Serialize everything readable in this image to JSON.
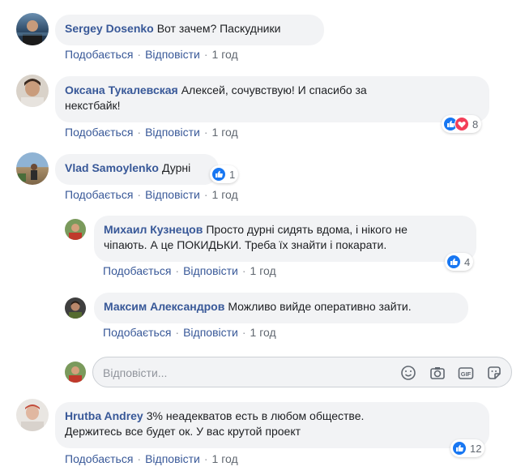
{
  "comments": [
    {
      "author": "Sergey Dosenko",
      "text": "Вот зачем? Паскудники",
      "like": "Подобається",
      "reply": "Відповісти",
      "time": "1 год"
    },
    {
      "author": "Оксана Тукалевская",
      "text_line1": "Алексей, сочувствую! И спасибо за",
      "text_line2": "некстбайк!",
      "like": "Подобається",
      "reply": "Відповісти",
      "time": "1 год",
      "reactions": {
        "count": "8",
        "icons": [
          "like-icon",
          "love-icon"
        ]
      }
    },
    {
      "author": "Vlad Samoylenko",
      "text": "Дурні",
      "like": "Подобається",
      "reply": "Відповісти",
      "time": "1 год",
      "reactions": {
        "count": "1",
        "icons": [
          "like-icon"
        ]
      }
    },
    {
      "author": "Hrutba Andrey",
      "text_line1": "3% неадекватов есть в любом обществе.",
      "text_line2": "Держитесь все будет ок. У вас крутой проект",
      "like": "Подобається",
      "reply": "Відповісти",
      "time": "1 год",
      "reactions": {
        "count": "12",
        "icons": [
          "like-icon"
        ]
      }
    }
  ],
  "replies": [
    {
      "author": "Михаил Кузнецов",
      "text_line1": "Просто дурні сидять вдома, і нікого не",
      "text_line2": "чіпають. А це ПОКИДЬКИ. Треба їх знайти і покарати.",
      "like": "Подобається",
      "reply": "Відповісти",
      "time": "1 год",
      "reactions": {
        "count": "4",
        "icons": [
          "like-icon"
        ]
      }
    },
    {
      "author": "Максим Александров",
      "text": "Можливо вийде оперативно зайти.",
      "like": "Подобається",
      "reply": "Відповісти",
      "time": "1 год"
    }
  ],
  "reply_box": {
    "placeholder": "Відповісти...",
    "icons": [
      "emoji-icon",
      "camera-icon",
      "gif-icon",
      "sticker-icon"
    ]
  },
  "colors": {
    "link": "#385898",
    "bubble": "#f2f3f5",
    "like": "#1877f2",
    "love": "#f33e58",
    "meta": "#606770"
  }
}
